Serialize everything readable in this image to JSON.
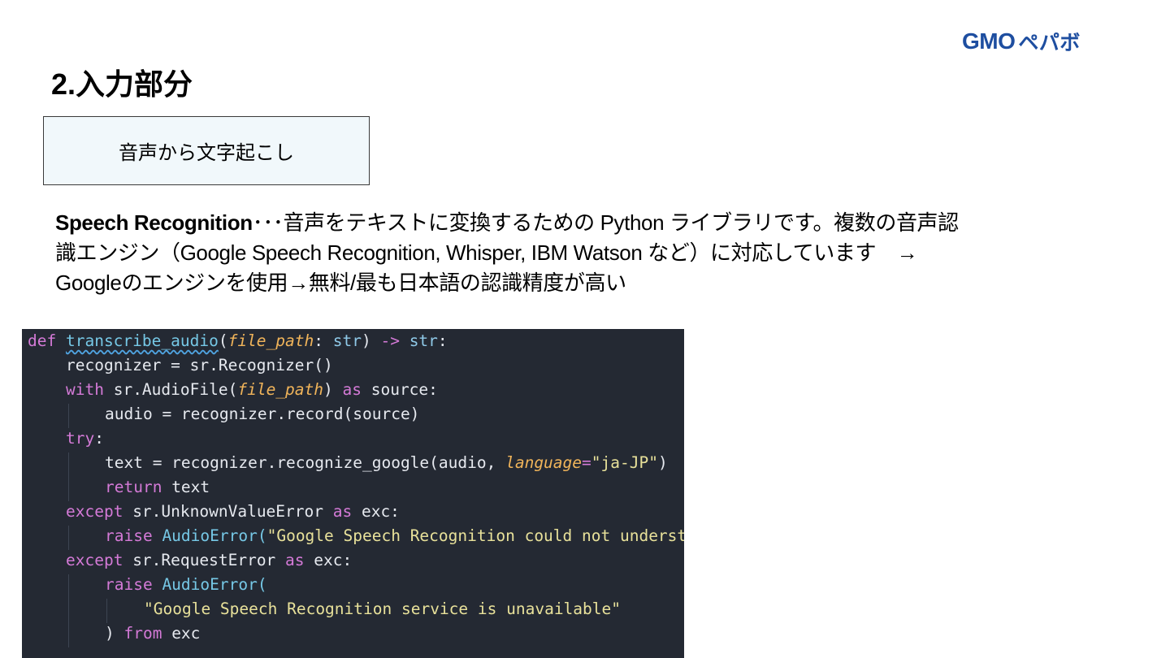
{
  "logo": {
    "text_gmo": "GMO",
    "text_kana": "ペパボ"
  },
  "page_title": "2.入力部分",
  "label_box": "音声から文字起こし",
  "description": {
    "term": "Speech Recognition",
    "line1_rest": "･･･音声をテキストに変換するための Python ライブラリです。複数の音声認",
    "line2": "識エンジン（Google Speech Recognition, Whisper, IBM Watson など）に対応しています　→",
    "line3": "Googleのエンジンを使用→無料/最も日本語の認識精度が高い"
  },
  "code": {
    "l1": {
      "def": "def",
      "name": "transcribe_audio",
      "p1": "(",
      "param": "file_path",
      "colon": ": ",
      "type": "str",
      "p2": ") ",
      "arrow": "->",
      "sp": " ",
      "ret": "str",
      "end": ":"
    },
    "l2": "recognizer = sr.Recognizer()",
    "l3": {
      "with": "with",
      "a": " sr.AudioFile(",
      "param": "file_path",
      "b": ") ",
      "as": "as",
      "c": " source:"
    },
    "l4": "audio = recognizer.record(source)",
    "l5": {
      "try": "try",
      "colon": ":"
    },
    "l6": {
      "a": "text = recognizer.recognize_google(audio, ",
      "kw": "language",
      "eq": "=",
      "str": "\"ja-JP\"",
      "end": ")"
    },
    "l7": {
      "ret": "return",
      "rest": " text"
    },
    "l8": {
      "except": "except",
      "a": " sr.UnknownValueError ",
      "as": "as",
      "b": " exc:"
    },
    "l9": {
      "raise": "raise",
      "cls": " AudioError(",
      "str": "\"Google Speech Recognition could not understand audio\"",
      "end": ")"
    },
    "l10": {
      "except": "except",
      "a": " sr.RequestError ",
      "as": "as",
      "b": " exc:"
    },
    "l11": {
      "raise": "raise",
      "cls": " AudioError("
    },
    "l12": "\"Google Speech Recognition service is unavailable\"",
    "l13": {
      "a": ") ",
      "from": "from",
      "b": " exc"
    }
  }
}
